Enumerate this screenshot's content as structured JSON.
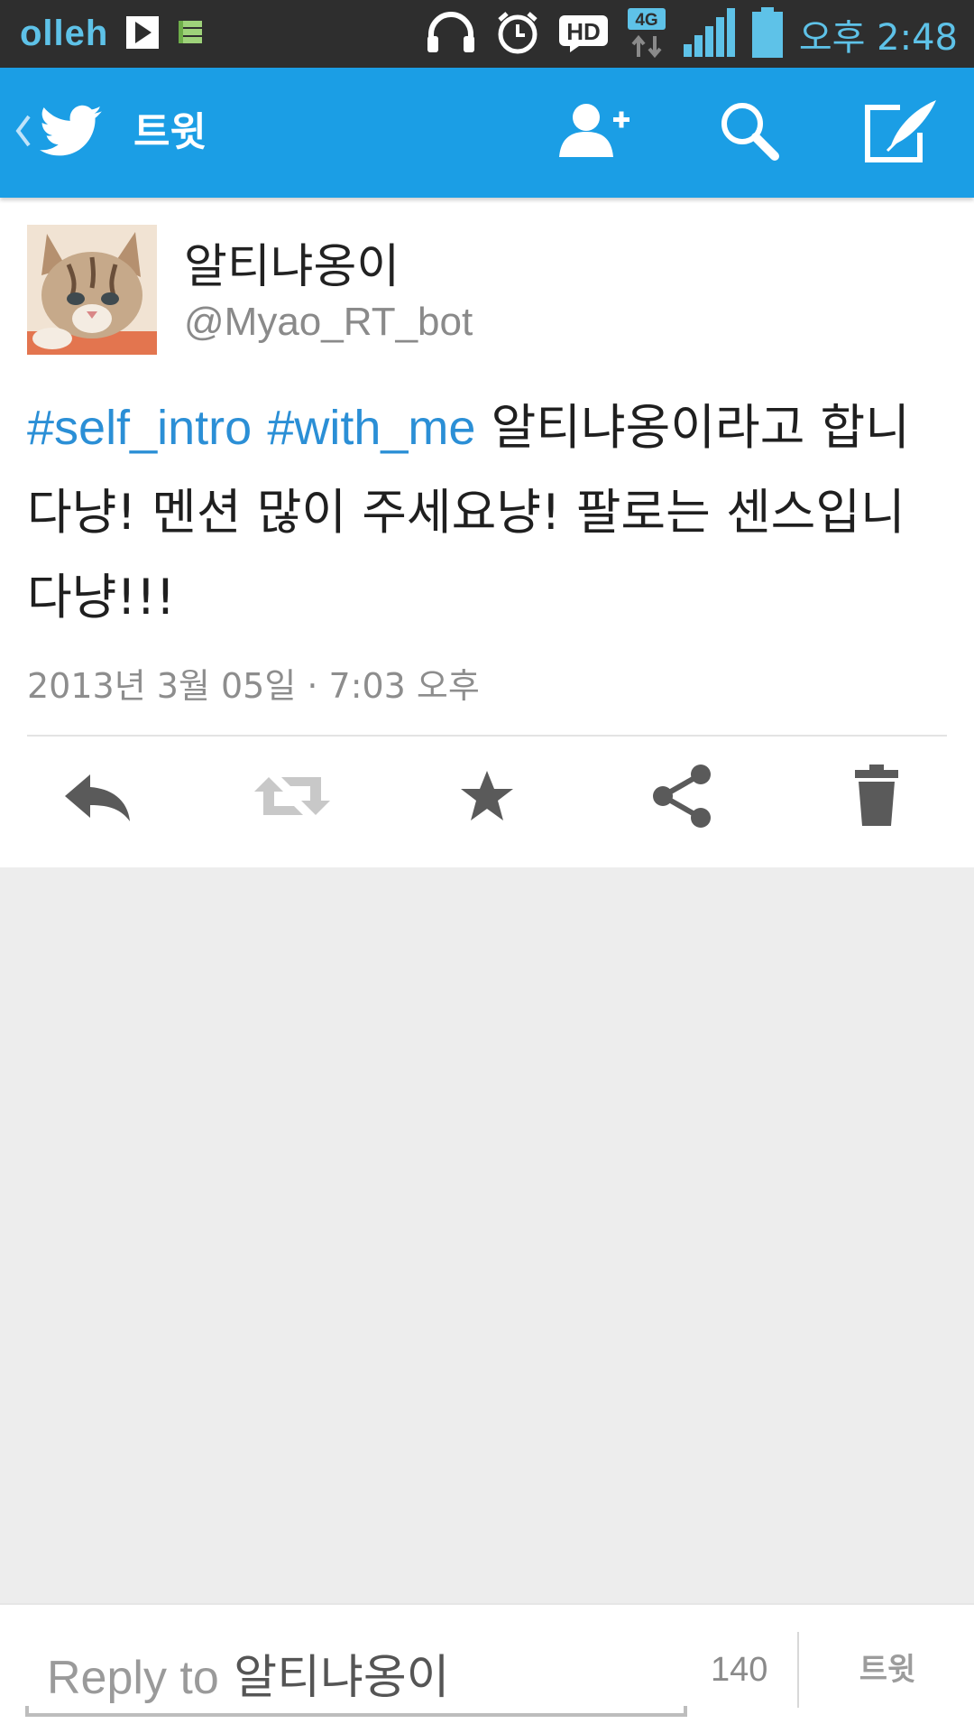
{
  "status_bar": {
    "carrier": "olleh",
    "network": "4G",
    "hd_label": "HD",
    "time": "오후 2:48",
    "icons": [
      "play-store-icon",
      "storage-icon",
      "headphones-icon",
      "alarm-icon",
      "hd-icon",
      "network-4g-icon",
      "signal-icon",
      "battery-icon"
    ],
    "color": "#5ec2e8"
  },
  "app_bar": {
    "title": "트윗",
    "icons": [
      "back-chevron-icon",
      "twitter-bird-icon",
      "add-user-icon",
      "search-icon",
      "compose-icon"
    ],
    "color": "#1b9ee5"
  },
  "tweet": {
    "display_name": "알티냐옹이",
    "screen_name": "@Myao_RT_bot",
    "hashtags": [
      "#self_intro",
      "#with_me"
    ],
    "text_after_hashtags": "알티냐옹이라고 합니다냥! 멘션 많이 주세요냥! 팔로는 센스입니다냥!!!",
    "timestamp": "2013년 3월 05일 · 7:03 오후",
    "hashtag_color": "#2b8fd6",
    "actions": [
      "reply-icon",
      "retweet-icon",
      "favorite-star-icon",
      "share-icon",
      "delete-trash-icon"
    ]
  },
  "reply": {
    "placeholder_lead": "Reply to",
    "placeholder_target": "알티냐옹이",
    "char_count": "140",
    "tweet_button": "트윗"
  }
}
